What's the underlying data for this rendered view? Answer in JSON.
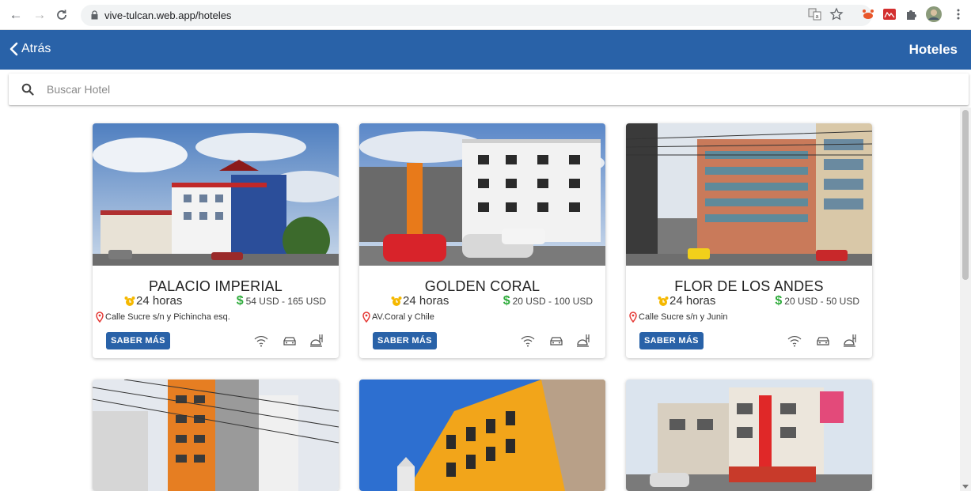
{
  "browser": {
    "url": "vive-tulcan.web.app/hoteles",
    "nav": {
      "back": "←",
      "forward": "→",
      "reload": "C"
    }
  },
  "appbar": {
    "back_label": "Atrás",
    "title": "Hoteles",
    "color": "#2962a8"
  },
  "search": {
    "placeholder": "Buscar Hotel",
    "value": ""
  },
  "hotels": [
    {
      "name": "PALACIO IMPERIAL",
      "hours": "24 horas",
      "price": "54 USD - 165 USD",
      "address": "Calle Sucre s/n y Pichincha esq.",
      "button": "SABER MÁS"
    },
    {
      "name": "GOLDEN CORAL",
      "hours": "24 horas",
      "price": "20 USD - 100 USD",
      "address": "AV.Coral y Chile",
      "button": "SABER MÁS"
    },
    {
      "name": "FLOR DE LOS ANDES",
      "hours": "24 horas",
      "price": "20 USD - 50 USD",
      "address": "Calle Sucre s/n y Junin",
      "button": "SABER MÁS"
    }
  ],
  "amenity_icons": [
    "wifi-icon",
    "car-icon",
    "room-service-icon"
  ],
  "colors": {
    "accent": "#2962a8",
    "price": "#2eab3b",
    "pin": "#e53935",
    "clock": "#f5b800"
  }
}
